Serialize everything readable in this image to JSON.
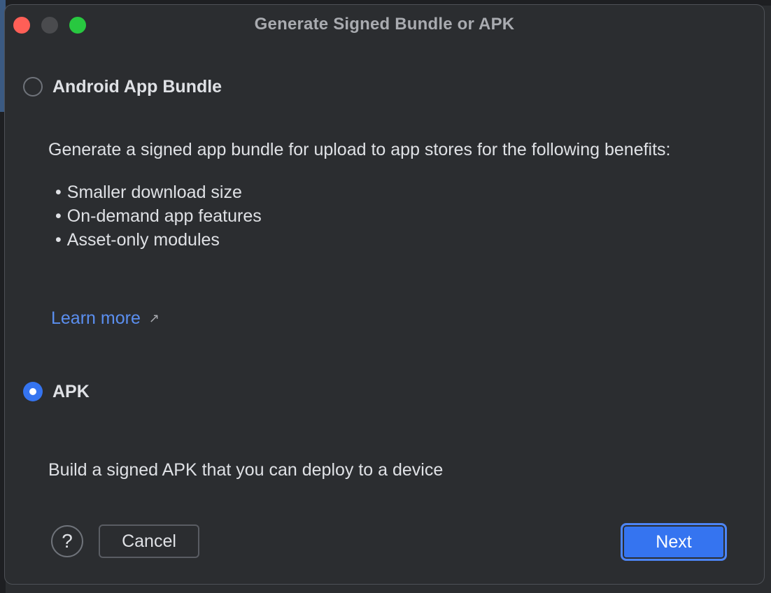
{
  "window": {
    "title": "Generate Signed Bundle or APK"
  },
  "options": {
    "bundle": {
      "label": "Android App Bundle",
      "checked": false,
      "description": "Generate a signed app bundle for upload to app stores for the following benefits:",
      "benefits": [
        "Smaller download size",
        "On-demand app features",
        "Asset-only modules"
      ],
      "learn_more": "Learn more",
      "learn_more_icon": "external-link-arrow-icon"
    },
    "apk": {
      "label": "APK",
      "checked": true,
      "description": "Build a signed APK that you can deploy to a device"
    }
  },
  "footer": {
    "help_label": "?",
    "cancel_label": "Cancel",
    "next_label": "Next"
  },
  "colors": {
    "background": "#2b2d30",
    "accent": "#3574f0",
    "link": "#5b8ff0",
    "text": "#dfe1e5",
    "close": "#ff5f57",
    "zoom": "#28c840"
  }
}
